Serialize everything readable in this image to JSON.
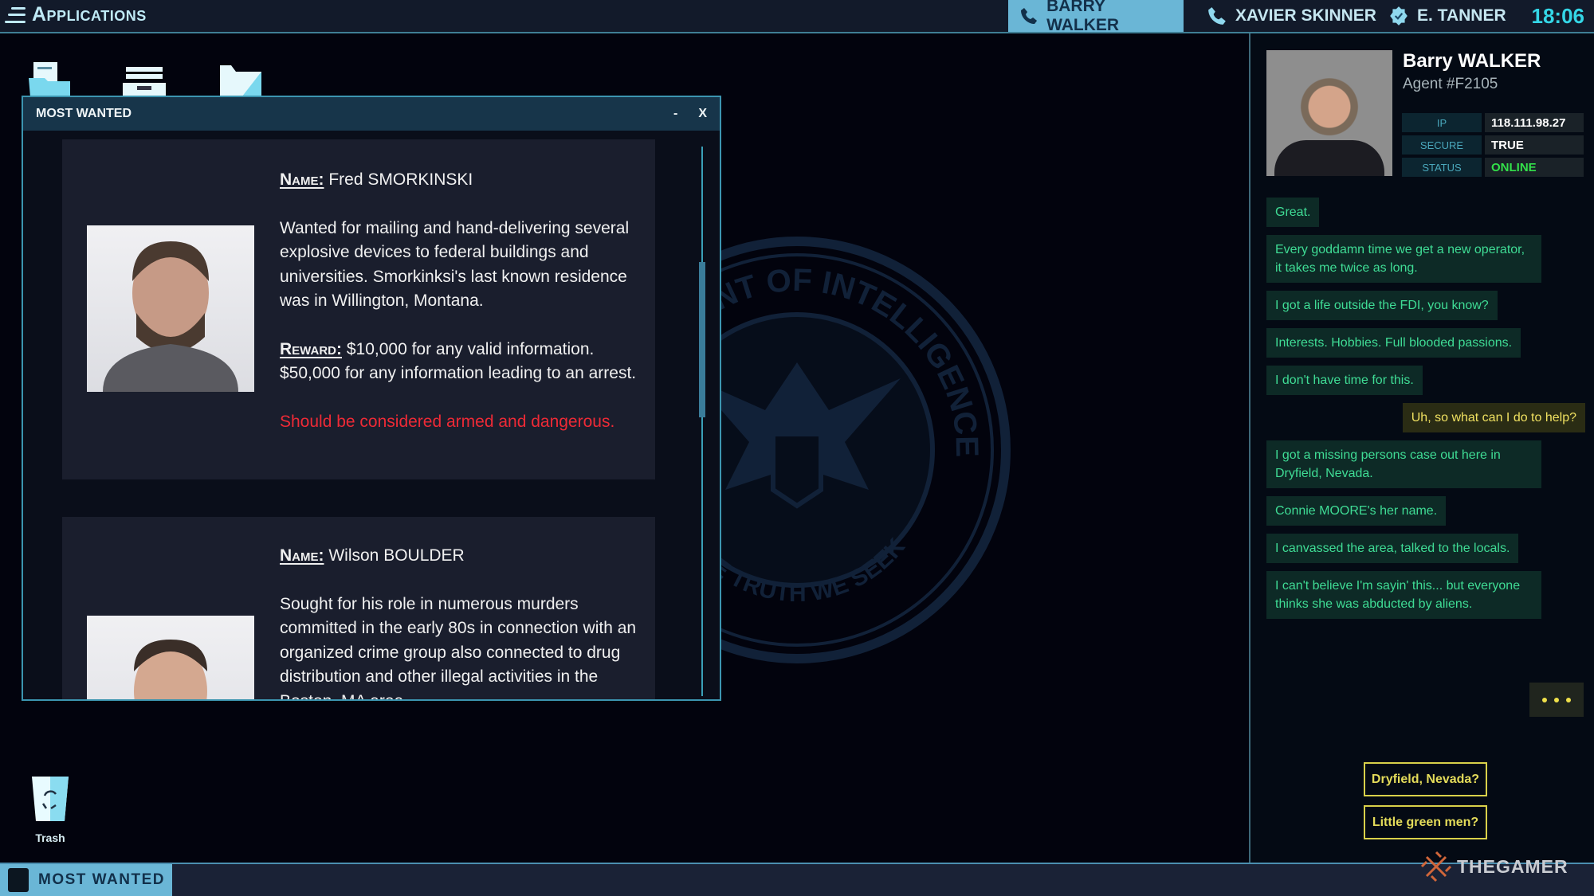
{
  "topbar": {
    "apps_label": "Applications",
    "tabs": [
      {
        "label": "BARRY WALKER",
        "icon": "phone-icon",
        "active": true
      },
      {
        "label": "XAVIER SKINNER",
        "icon": "phone-icon",
        "active": false
      },
      {
        "label": "E. TANNER",
        "icon": "verified-badge-icon",
        "active": false
      }
    ],
    "clock": "18:06"
  },
  "window": {
    "title": "MOST WANTED",
    "minimize": "-",
    "close": "X",
    "cards": [
      {
        "name_label": "Name:",
        "name": "Fred SMORKINSKI",
        "description": "Wanted for mailing and hand-delivering several explosive devices to federal buildings and universities. Smorkinksi's last known residence was in Willington, Montana.",
        "reward_label": "Reward:",
        "reward": "$10,000 for any valid information. $50,000 for any information leading to an arrest.",
        "warning": "Should be considered armed and dangerous."
      },
      {
        "name_label": "Name:",
        "name": "Wilson BOULDER",
        "description": "Sought for his role in numerous murders committed in the early 80s in connection with an organized crime group also connected to drug distribution and other illegal activities in the Boston, MA area."
      }
    ]
  },
  "agent": {
    "name": "Barry WALKER",
    "id": "Agent #F2105",
    "info": [
      {
        "key": "IP",
        "value": "118.111.98.27"
      },
      {
        "key": "SECURE",
        "value": "TRUE"
      },
      {
        "key": "STATUS",
        "value": "ONLINE",
        "color": "#33e04a"
      }
    ]
  },
  "chat": [
    {
      "text": "Great.",
      "from": "agent"
    },
    {
      "text": "Every goddamn time we get a new operator, it takes me twice as long.",
      "from": "agent"
    },
    {
      "text": "I got a life outside the FDI, you know?",
      "from": "agent"
    },
    {
      "text": "Interests. Hobbies. Full blooded passions.",
      "from": "agent"
    },
    {
      "text": "I don't have time for this.",
      "from": "agent"
    },
    {
      "text": "Uh, so what can I do to help?",
      "from": "me"
    },
    {
      "text": "I got a missing persons case out here in Dryfield, Nevada.",
      "from": "agent"
    },
    {
      "text": "Connie MOORE's her name.",
      "from": "agent"
    },
    {
      "text": "I canvassed the area, talked to the locals.",
      "from": "agent"
    },
    {
      "text": "I can't believe I'm sayin' this... but everyone thinks she was abducted by aliens.",
      "from": "agent"
    }
  ],
  "choices": [
    "Dryfield, Nevada?",
    "Little green men?"
  ],
  "desktop": {
    "trash_label": "Trash"
  },
  "taskbar": {
    "items": [
      {
        "label": "MOST WANTED",
        "active": true
      }
    ]
  },
  "watermark": "THEGAMER",
  "seal_text": {
    "top": "DEPARTMENT OF INTELLIGENCE",
    "bottom": "THE TRUTH WE SEEK"
  }
}
